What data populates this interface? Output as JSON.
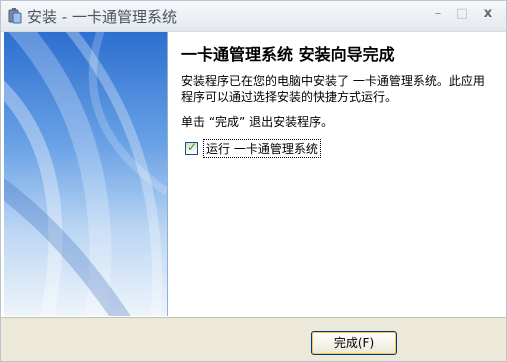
{
  "window": {
    "title": "安装 - 一卡通管理系统",
    "controls": {
      "minimize": "–",
      "maximize": "□",
      "close": "x"
    }
  },
  "content": {
    "heading": "一卡通管理系统 安装向导完成",
    "body": "安装程序已在您的电脑中安装了 一卡通管理系统。此应用程序可以通过选择安装的快捷方式运行。",
    "exit_instruction": "单击 “完成” 退出安装程序。",
    "run_checkbox": {
      "label": "运行 一卡通管理系统",
      "checked": true,
      "check_glyph": "✓"
    }
  },
  "footer": {
    "finish_button": "完成(F)"
  },
  "icons": {
    "app": "installer-app-icon",
    "checkmark": "checkmark-icon"
  },
  "colors": {
    "accent_blue": "#2d6fd0",
    "footer_bg": "#ece9d8",
    "check_green": "#21a121"
  }
}
